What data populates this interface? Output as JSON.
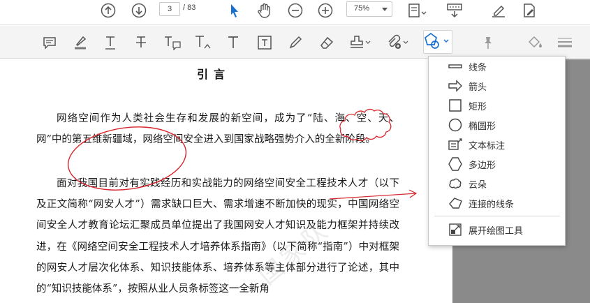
{
  "navigation": {
    "current_page": "3",
    "page_total": "/ 83",
    "zoom": "75%"
  },
  "document": {
    "title": "引言",
    "paragraphs": [
      "网络空间作为人类社会生存和发展的新空间，成为了“陆、海、空、天、网”中的第五维新疆域，网络空间安全进入到国家战略强势介入的全新阶段。",
      "面对我国目前对有实践经历和实战能力的网络空间安全工程技术人才（以下及正文简称“网安人才”）需求缺口巨大、需求增速不断加快的现实，中国网络空间安全人才教育论坛汇聚成员单位提出了我国网安人才知识及能力框架并持续改进，在《网络空间安全工程技术人才培养体系指南》（以下简称“指南”）中对框架的网安人才层次化体系、知识技能体系、培养体系等主体部分进行了论述，其中的“知识技能体系”，按照从业人员条标签这一全新角"
    ],
    "watermark": "国家队"
  },
  "shapes_menu": {
    "items": [
      {
        "label": "线条",
        "icon": "line-icon"
      },
      {
        "label": "箭头",
        "icon": "arrow-icon"
      },
      {
        "label": "矩形",
        "icon": "rectangle-icon"
      },
      {
        "label": "椭圆形",
        "icon": "oval-icon"
      },
      {
        "label": "文本标注",
        "icon": "text-callout-icon"
      },
      {
        "label": "多边形",
        "icon": "polygon-icon"
      },
      {
        "label": "云朵",
        "icon": "cloud-icon"
      },
      {
        "label": "连接的线条",
        "icon": "connected-lines-icon"
      }
    ],
    "expand_label": "展开绘图工具"
  },
  "colors": {
    "accent": "#1a6fcf",
    "annotation_red": "#d8232a",
    "toolbar_icon": "#555555"
  }
}
